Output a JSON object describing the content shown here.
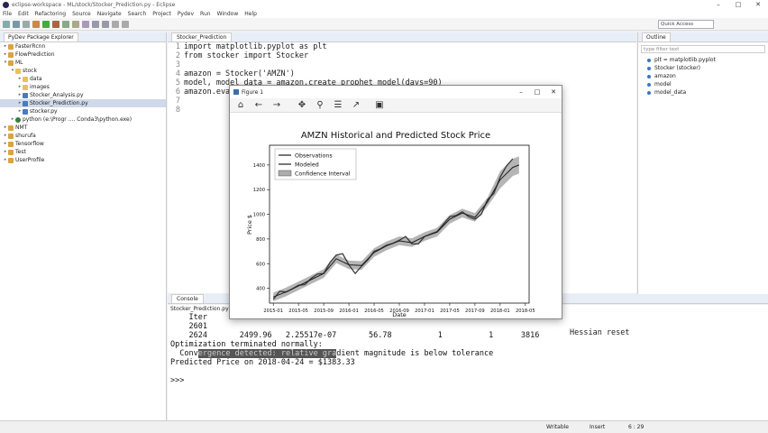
{
  "window": {
    "title": "eclipse-workspace - ML/stock/Stocker_Prediction.py - Eclipse",
    "controls": [
      "–",
      "□",
      "✕"
    ]
  },
  "menu": [
    "File",
    "Edit",
    "Refactoring",
    "Source",
    "Navigate",
    "Search",
    "Project",
    "Pydev",
    "Run",
    "Window",
    "Help"
  ],
  "toolbar": {
    "quick_access": "Quick Access"
  },
  "explorer": {
    "tab": "PyDev Package Explorer",
    "items": [
      {
        "label": "FasterRcnn",
        "icon": "project-icon",
        "depth": 0,
        "twisty": "▸"
      },
      {
        "label": "FlowPrediction",
        "icon": "project-icon",
        "depth": 0,
        "twisty": "▸"
      },
      {
        "label": "ML",
        "icon": "project-icon",
        "depth": 0,
        "twisty": "▾"
      },
      {
        "label": "stock",
        "icon": "folder-icon",
        "depth": 1,
        "twisty": "▾"
      },
      {
        "label": "data",
        "icon": "folder-icon",
        "depth": 2,
        "twisty": "▸"
      },
      {
        "label": "images",
        "icon": "folder-icon",
        "depth": 2,
        "twisty": "▸"
      },
      {
        "label": "Stocker_Analysis.py",
        "icon": "python-file-icon",
        "depth": 2,
        "twisty": "▸"
      },
      {
        "label": "Stocker_Prediction.py",
        "icon": "python-file-icon",
        "depth": 2,
        "twisty": "▸",
        "selected": true
      },
      {
        "label": "stocker.py",
        "icon": "python-file-icon",
        "depth": 2,
        "twisty": "▸"
      },
      {
        "label": "python  (e:\\Progr .... Conda3\\python.exe)",
        "icon": "python-env-icon",
        "depth": 1,
        "twisty": "▸"
      },
      {
        "label": "NMT",
        "icon": "project-icon",
        "depth": 0,
        "twisty": "▸"
      },
      {
        "label": "shurufa",
        "icon": "project-icon",
        "depth": 0,
        "twisty": "▸"
      },
      {
        "label": "Tensorflow",
        "icon": "project-icon",
        "depth": 0,
        "twisty": "▸"
      },
      {
        "label": "Test",
        "icon": "project-icon",
        "depth": 0,
        "twisty": "▸"
      },
      {
        "label": "UserProfile",
        "icon": "project-icon",
        "depth": 0,
        "twisty": "▸"
      }
    ]
  },
  "editor": {
    "tab": "Stocker_Prediction",
    "lines": [
      {
        "n": "1",
        "text": "import matplotlib.pyplot as plt"
      },
      {
        "n": "2",
        "text": "from stocker import Stocker"
      },
      {
        "n": "3",
        "text": ""
      },
      {
        "n": "4",
        "text": "amazon = Stocker('AMZN')"
      },
      {
        "n": "5",
        "text": "model, model_data = amazon.create_prophet_model(days=90)"
      },
      {
        "n": "6",
        "text": "amazon.eva"
      },
      {
        "n": "7",
        "text": ""
      },
      {
        "n": "8",
        "text": ""
      }
    ]
  },
  "outline": {
    "tab": "Outline",
    "filter_placeholder": "type filter text",
    "items": [
      "plt = matplotlib.pyplot",
      "Stocker (stocker)",
      "amazon",
      "model",
      "model_data"
    ]
  },
  "console": {
    "tab": "Console",
    "path": "Stocker_Prediction.py [d",
    "lines": [
      "    Iter",
      "    2601",
      "    2624       2499.96   2.25517e-07       56.78          1          1      3816",
      "Optimization terminated normally:",
      "  Convergence detected: relative gradient magnitude is below tolerance",
      "Predicted Price on 2018-04-24 = $1383.33",
      "",
      ">>>"
    ],
    "trailing_text": "Hessian reset"
  },
  "status": {
    "writable": "Writable",
    "insert": "Insert",
    "position": "6 : 29"
  },
  "figure": {
    "title": "Figure 1",
    "toolbar_icons": [
      "home-icon",
      "back-icon",
      "forward-icon",
      "pan-icon",
      "zoom-icon",
      "configure-icon",
      "edit-axis-icon",
      "save-icon"
    ]
  },
  "colors": {
    "highlight": "#555555",
    "band": "#5b5b5b",
    "observations": "#3a3a3a",
    "modeled": "#1d1d1d"
  },
  "chart_data": {
    "type": "line",
    "title": "AMZN Historical and Predicted Stock Price",
    "xlabel": "Date",
    "ylabel": "Price $",
    "x_ticks": [
      "2015-01",
      "2015-05",
      "2015-09",
      "2016-01",
      "2016-05",
      "2016-09",
      "2017-01",
      "2017-05",
      "2017-09",
      "2018-01",
      "2018-05"
    ],
    "y_ticks": [
      400,
      600,
      800,
      1000,
      1200,
      1400
    ],
    "ylim": [
      280,
      1560
    ],
    "legend": [
      "Observations",
      "Modeled",
      "Confidence Interval"
    ],
    "legend_position": "top-left",
    "series": [
      {
        "name": "Observations",
        "x": [
          "2015-01",
          "2015-02",
          "2015-03",
          "2015-04",
          "2015-05",
          "2015-06",
          "2015-07",
          "2015-08",
          "2015-09",
          "2015-10",
          "2015-11",
          "2015-12",
          "2016-01",
          "2016-02",
          "2016-03",
          "2016-04",
          "2016-05",
          "2016-06",
          "2016-07",
          "2016-08",
          "2016-09",
          "2016-10",
          "2016-11",
          "2016-12",
          "2017-01",
          "2017-02",
          "2017-03",
          "2017-04",
          "2017-05",
          "2017-06",
          "2017-07",
          "2017-08",
          "2017-09",
          "2017-10",
          "2017-11",
          "2017-12",
          "2018-01",
          "2018-02",
          "2018-03"
        ],
        "y": [
          310,
          375,
          370,
          395,
          425,
          430,
          480,
          515,
          520,
          610,
          670,
          680,
          590,
          520,
          580,
          630,
          700,
          720,
          750,
          765,
          790,
          820,
          760,
          760,
          820,
          840,
          860,
          920,
          980,
          990,
          1020,
          980,
          960,
          1000,
          1120,
          1170,
          1300,
          1390,
          1450
        ]
      },
      {
        "name": "Modeled",
        "x": [
          "2015-01",
          "2015-03",
          "2015-05",
          "2015-07",
          "2015-09",
          "2015-11",
          "2016-01",
          "2016-03",
          "2016-05",
          "2016-07",
          "2016-09",
          "2016-11",
          "2017-01",
          "2017-03",
          "2017-05",
          "2017-07",
          "2017-09",
          "2017-11",
          "2018-01",
          "2018-03",
          "2018-04"
        ],
        "y": [
          330,
          370,
          420,
          470,
          520,
          640,
          590,
          585,
          690,
          745,
          785,
          770,
          820,
          855,
          960,
          1010,
          975,
          1100,
          1280,
          1380,
          1400
        ]
      }
    ]
  }
}
